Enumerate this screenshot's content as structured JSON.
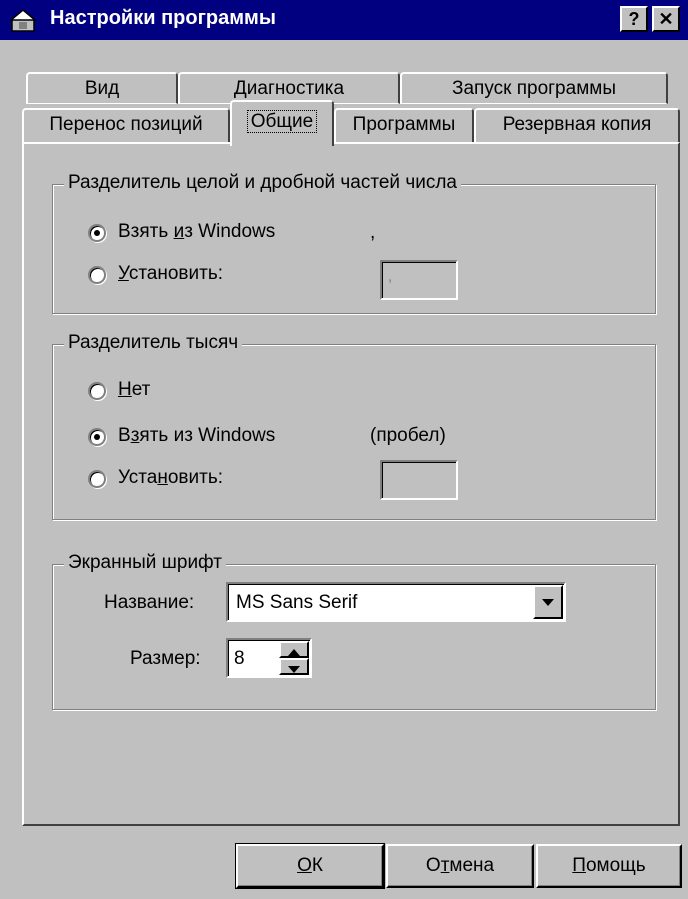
{
  "window": {
    "title": "Настройки программы",
    "help_button": "?",
    "close_button": "✕"
  },
  "tabs_row1": [
    "Вид",
    "Диагностика",
    "Запуск программы"
  ],
  "tabs_row2": [
    "Перенос позиций",
    "Общие",
    "Программы",
    "Резервная копия"
  ],
  "active_tab": "Общие",
  "decimal_separator": {
    "legend": "Разделитель целой и дробной частей числа",
    "option_windows": {
      "pre": "Взять ",
      "hot": "и",
      "post": "з Windows",
      "selected": true
    },
    "windows_value": ",",
    "option_set": {
      "pre": "",
      "hot": "У",
      "post": "становить:",
      "selected": false
    },
    "set_value": ","
  },
  "thousands_separator": {
    "legend": "Разделитель тысяч",
    "option_none": {
      "pre": "",
      "hot": "Н",
      "post": "ет",
      "selected": false
    },
    "option_windows": {
      "pre": "В",
      "hot": "з",
      "post": "ять из Windows",
      "selected": true
    },
    "windows_value": "(пробел)",
    "option_set": {
      "pre": "Уста",
      "hot": "н",
      "post": "овить:",
      "selected": false
    },
    "set_value": ""
  },
  "screen_font": {
    "legend": "Экранный шрифт",
    "name_label": "Название:",
    "name_value": "MS Sans Serif",
    "size_label": "Размер:",
    "size_value": "8"
  },
  "buttons": {
    "ok": {
      "pre": "",
      "hot": "О",
      "post": "К"
    },
    "cancel": {
      "pre": "О",
      "hot": "т",
      "post": "мена"
    },
    "help": {
      "pre": "",
      "hot": "П",
      "post": "омощь"
    }
  }
}
